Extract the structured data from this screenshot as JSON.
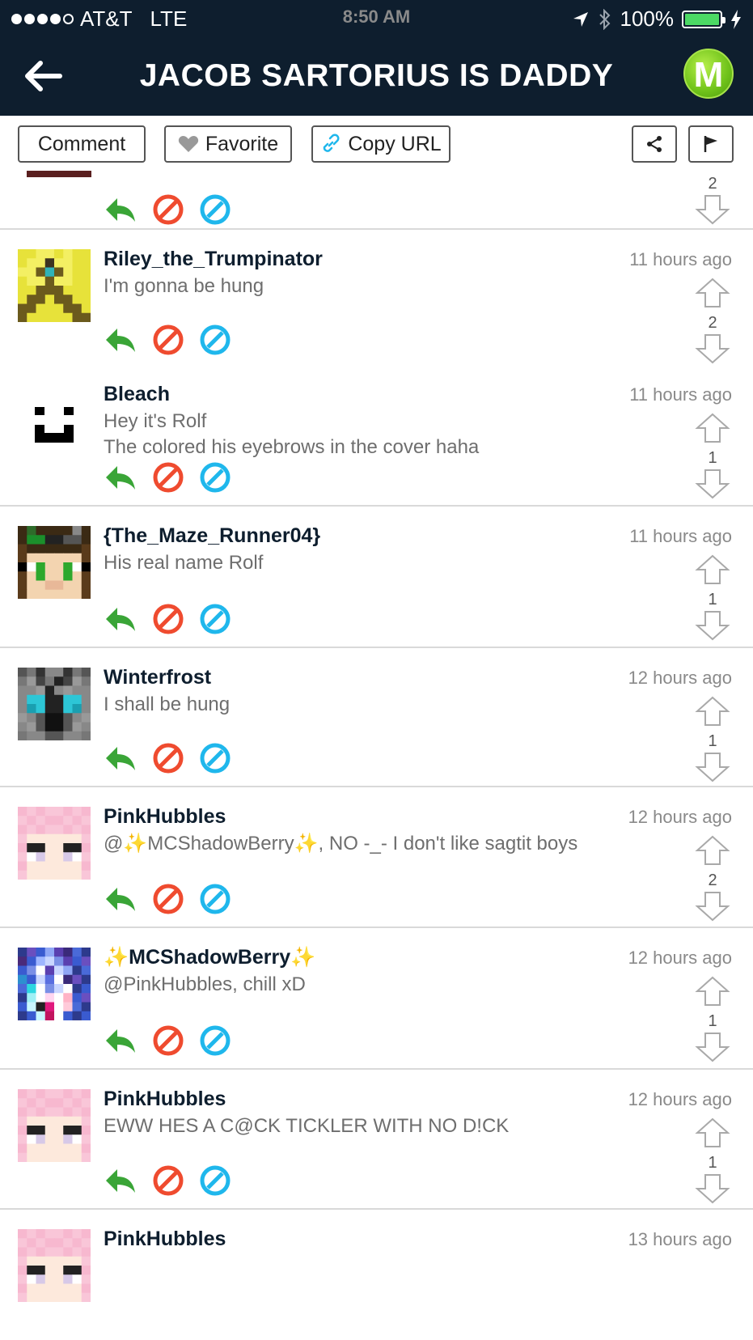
{
  "status": {
    "carrier": "AT&T",
    "network": "LTE",
    "time": "8:50 AM",
    "battery": "100%"
  },
  "header": {
    "title": "JACOB SARTORIUS IS DADDY",
    "logo_letter": "M",
    "back_icon": "arrow-left-icon"
  },
  "toolbar": {
    "comment": "Comment",
    "favorite": "Favorite",
    "copy_url": "Copy URL"
  },
  "colors": {
    "header_bg": "#0e1e2e",
    "reply": "#3aa537",
    "block": "#ef4b2f",
    "ignore": "#1fb7ec",
    "username": "#0e1e2e",
    "timestamp": "#8a8a8a"
  },
  "partial_row": {
    "votes": "2"
  },
  "comments": [
    {
      "username": "Riley_the_Trumpinator",
      "time": "11 hours ago",
      "lines": [
        "I'm gonna be hung"
      ],
      "votes": "2"
    },
    {
      "username": "Bleach",
      "time": "11 hours ago",
      "lines": [
        "Hey it's Rolf",
        "The colored his eyebrows in the cover haha"
      ],
      "votes": "1"
    },
    {
      "username": "{The_Maze_Runner04}",
      "time": "11 hours ago",
      "lines": [
        "His real name Rolf"
      ],
      "votes": "1"
    },
    {
      "username": "Winterfrost",
      "time": "12 hours ago",
      "lines": [
        "I shall be hung"
      ],
      "votes": "1"
    },
    {
      "username": "PinkHubbles",
      "time": "12 hours ago",
      "lines": [
        "@✨MCShadowBerry✨, NO -_- I don't like sagtit boys"
      ],
      "votes": "2"
    },
    {
      "username": "✨MCShadowBerry✨",
      "time": "12 hours ago",
      "lines": [
        "@PinkHubbles, chill xD"
      ],
      "votes": "1"
    },
    {
      "username": "PinkHubbles",
      "time": "12 hours ago",
      "lines": [
        "EWW HES A C@CK TICKLER WITH NO D!CK"
      ],
      "votes": "1"
    },
    {
      "username": "PinkHubbles",
      "time": "13 hours ago",
      "lines": [],
      "votes": ""
    }
  ]
}
